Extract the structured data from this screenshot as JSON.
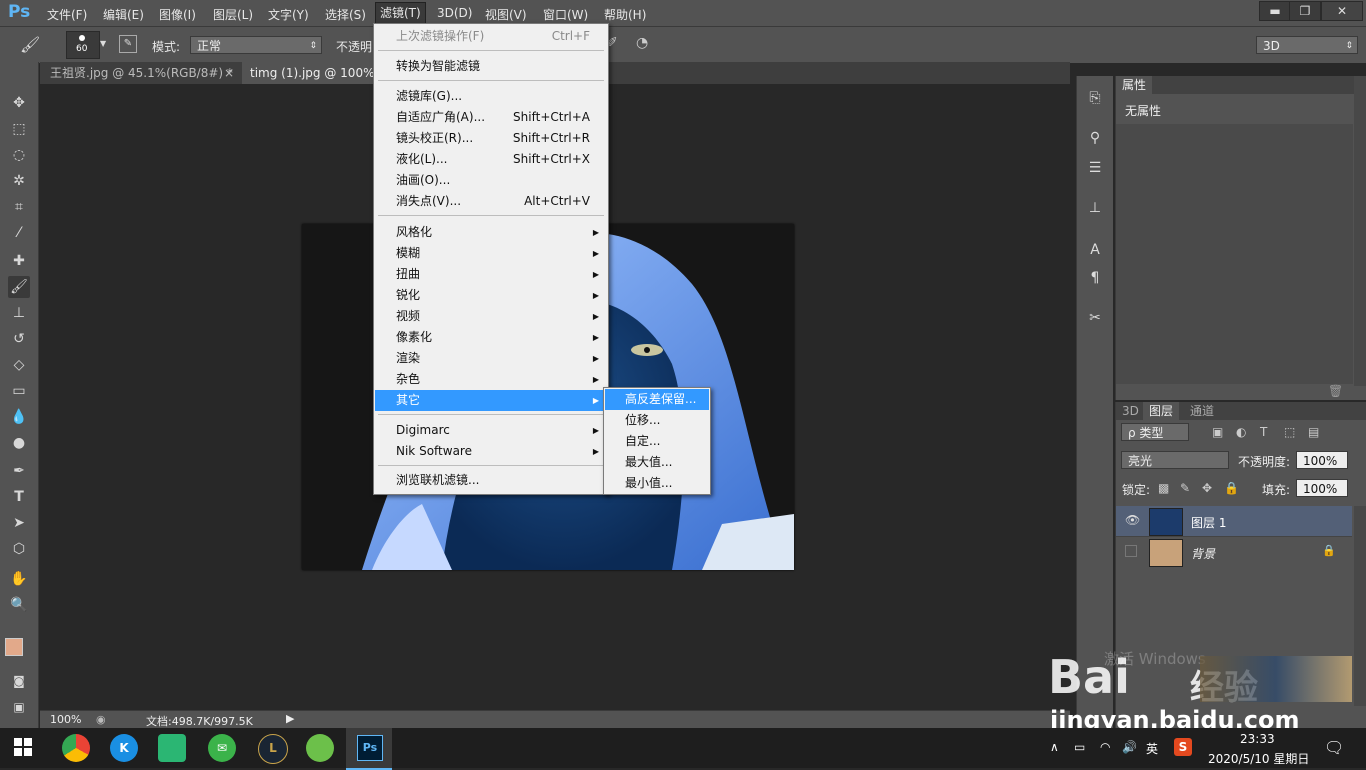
{
  "app": {
    "logo": "Ps"
  },
  "menubar": {
    "items": [
      {
        "label": "文件(F)"
      },
      {
        "label": "编辑(E)"
      },
      {
        "label": "图像(I)"
      },
      {
        "label": "图层(L)"
      },
      {
        "label": "文字(Y)"
      },
      {
        "label": "选择(S)"
      },
      {
        "label": "滤镜(T)"
      },
      {
        "label": "3D(D)"
      },
      {
        "label": "视图(V)"
      },
      {
        "label": "窗口(W)"
      },
      {
        "label": "帮助(H)"
      }
    ],
    "window_controls": {
      "minimize": "▬",
      "restore": "❐",
      "close": "✕"
    }
  },
  "options": {
    "brush_size": "60",
    "mode_label": "模式:",
    "mode_value": "正常",
    "opacity_label": "不透明",
    "workspace": "3D"
  },
  "tabs": [
    {
      "label": "王祖贤.jpg @ 45.1%(RGB/8#) *",
      "close": "×"
    },
    {
      "label": "timg (1).jpg @ 100% (图"
    }
  ],
  "filter_menu": {
    "items": [
      {
        "label": "上次滤镜操作(F)",
        "shortcut": "Ctrl+F",
        "disabled": true
      },
      {
        "label": "转换为智能滤镜"
      },
      {
        "label": "滤镜库(G)..."
      },
      {
        "label": "自适应广角(A)...",
        "shortcut": "Shift+Ctrl+A"
      },
      {
        "label": "镜头校正(R)...",
        "shortcut": "Shift+Ctrl+R"
      },
      {
        "label": "液化(L)...",
        "shortcut": "Shift+Ctrl+X"
      },
      {
        "label": "油画(O)..."
      },
      {
        "label": "消失点(V)...",
        "shortcut": "Alt+Ctrl+V"
      },
      {
        "label": "风格化"
      },
      {
        "label": "模糊"
      },
      {
        "label": "扭曲"
      },
      {
        "label": "锐化"
      },
      {
        "label": "视频"
      },
      {
        "label": "像素化"
      },
      {
        "label": "渲染"
      },
      {
        "label": "杂色"
      },
      {
        "label": "其它"
      },
      {
        "label": "Digimarc"
      },
      {
        "label": "Nik Software"
      },
      {
        "label": "浏览联机滤镜..."
      }
    ],
    "submenu_arrow": "▶"
  },
  "other_submenu": {
    "items": [
      {
        "label": "高反差保留..."
      },
      {
        "label": "位移..."
      },
      {
        "label": "自定..."
      },
      {
        "label": "最大值..."
      },
      {
        "label": "最小值..."
      }
    ]
  },
  "properties_panel": {
    "tab": "属性",
    "content": "无属性"
  },
  "layers_panel": {
    "tabs": [
      {
        "label": "3D"
      },
      {
        "label": "图层"
      },
      {
        "label": "通道"
      }
    ],
    "filter_label": "ρ 类型",
    "blend_mode": "亮光",
    "opacity_label": "不透明度:",
    "opacity_value": "100%",
    "lock_label": "锁定:",
    "fill_label": "填充:",
    "fill_value": "100%",
    "layers": [
      {
        "name": "图层 1",
        "visible": true,
        "selected": true
      },
      {
        "name": "背景",
        "visible": false,
        "locked": true
      }
    ]
  },
  "statusbar": {
    "zoom": "100%",
    "doc_info": "文档:498.7K/997.5K"
  },
  "taskbar": {
    "ime": "英",
    "time": "23:33",
    "date": "2020/5/10 星期日"
  },
  "watermark": {
    "brand": "Bai",
    "paw": "经验",
    "site": "jingyan.baidu.com",
    "activate": "激活 Windows"
  },
  "colors": {
    "highlight": "#3399ff",
    "ps_blue": "#5fb6f5",
    "panel": "#535353",
    "workspace": "#282828"
  }
}
